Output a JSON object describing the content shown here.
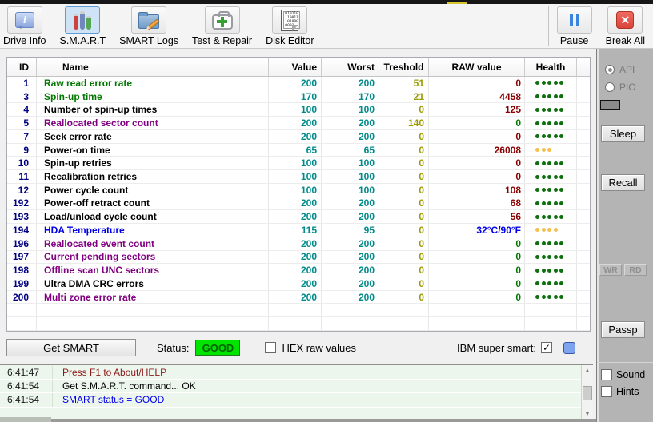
{
  "window": {
    "colors": {
      "toolbar_selected": "#cfe3f7",
      "status_good_bg": "#00e400",
      "status_good_text": "#006400",
      "sidebar_bg": "#b4b4b4",
      "log_bg": "#edf6ed",
      "id_navy": "#000080",
      "value_teal": "#008b8b",
      "treshold_olive": "#9c9c00",
      "raw_red": "#8b0000",
      "name_green": "#007800",
      "name_purple": "#800080",
      "name_blue": "#0000e8",
      "health_ok": "#0e6f0e",
      "health_warn": "#f6bf4a"
    }
  },
  "toolbar": {
    "buttons": [
      {
        "label": "Drive Info",
        "icon": "drive-info"
      },
      {
        "label": "S.M.A.R.T",
        "icon": "smart",
        "selected": true
      },
      {
        "label": "SMART Logs",
        "icon": "smart-logs"
      },
      {
        "label": "Test & Repair",
        "icon": "test-repair"
      },
      {
        "label": "Disk Editor",
        "icon": "disk-editor"
      }
    ],
    "disk_editor_binary": "010110\n110011\n101000\n0001",
    "right_buttons": [
      {
        "label": "Pause",
        "icon": "pause"
      },
      {
        "label": "Break All",
        "icon": "break-all"
      }
    ]
  },
  "table": {
    "columns": [
      "ID",
      "Name",
      "Value",
      "Worst",
      "Treshold",
      "RAW value",
      "Health"
    ],
    "empty_row_count": 2,
    "rows": [
      {
        "id": "1",
        "name": "Raw read error rate",
        "name_color": "green",
        "value": "200",
        "worst": "200",
        "treshold": "51",
        "raw": "0",
        "raw_color": "red",
        "health_dots": 5,
        "health_color": "green"
      },
      {
        "id": "3",
        "name": "Spin-up time",
        "name_color": "green",
        "value": "170",
        "worst": "170",
        "treshold": "21",
        "raw": "4458",
        "raw_color": "red",
        "health_dots": 5,
        "health_color": "green"
      },
      {
        "id": "4",
        "name": "Number of spin-up times",
        "name_color": "black",
        "value": "100",
        "worst": "100",
        "treshold": "0",
        "raw": "125",
        "raw_color": "red",
        "health_dots": 5,
        "health_color": "green"
      },
      {
        "id": "5",
        "name": "Reallocated sector count",
        "name_color": "purple",
        "value": "200",
        "worst": "200",
        "treshold": "140",
        "raw": "0",
        "raw_color": "green",
        "health_dots": 5,
        "health_color": "green"
      },
      {
        "id": "7",
        "name": "Seek error rate",
        "name_color": "black",
        "value": "200",
        "worst": "200",
        "treshold": "0",
        "raw": "0",
        "raw_color": "red",
        "health_dots": 5,
        "health_color": "green"
      },
      {
        "id": "9",
        "name": "Power-on time",
        "name_color": "black",
        "value": "65",
        "worst": "65",
        "treshold": "0",
        "raw": "26008",
        "raw_color": "red",
        "health_dots": 3,
        "health_color": "yellow"
      },
      {
        "id": "10",
        "name": "Spin-up retries",
        "name_color": "black",
        "value": "100",
        "worst": "100",
        "treshold": "0",
        "raw": "0",
        "raw_color": "red",
        "health_dots": 5,
        "health_color": "green"
      },
      {
        "id": "11",
        "name": "Recalibration retries",
        "name_color": "black",
        "value": "100",
        "worst": "100",
        "treshold": "0",
        "raw": "0",
        "raw_color": "red",
        "health_dots": 5,
        "health_color": "green"
      },
      {
        "id": "12",
        "name": "Power cycle count",
        "name_color": "black",
        "value": "100",
        "worst": "100",
        "treshold": "0",
        "raw": "108",
        "raw_color": "red",
        "health_dots": 5,
        "health_color": "green"
      },
      {
        "id": "192",
        "name": "Power-off retract count",
        "name_color": "black",
        "value": "200",
        "worst": "200",
        "treshold": "0",
        "raw": "68",
        "raw_color": "red",
        "health_dots": 5,
        "health_color": "green"
      },
      {
        "id": "193",
        "name": "Load/unload cycle count",
        "name_color": "black",
        "value": "200",
        "worst": "200",
        "treshold": "0",
        "raw": "56",
        "raw_color": "red",
        "health_dots": 5,
        "health_color": "green"
      },
      {
        "id": "194",
        "name": "HDA Temperature",
        "name_color": "blue",
        "value": "115",
        "worst": "95",
        "treshold": "0",
        "raw": "32°C/90°F",
        "raw_color": "blue",
        "health_dots": 4,
        "health_color": "yellow"
      },
      {
        "id": "196",
        "name": "Reallocated event count",
        "name_color": "purple",
        "value": "200",
        "worst": "200",
        "treshold": "0",
        "raw": "0",
        "raw_color": "green",
        "health_dots": 5,
        "health_color": "green"
      },
      {
        "id": "197",
        "name": "Current pending sectors",
        "name_color": "purple",
        "value": "200",
        "worst": "200",
        "treshold": "0",
        "raw": "0",
        "raw_color": "green",
        "health_dots": 5,
        "health_color": "green"
      },
      {
        "id": "198",
        "name": "Offline scan UNC sectors",
        "name_color": "purple",
        "value": "200",
        "worst": "200",
        "treshold": "0",
        "raw": "0",
        "raw_color": "green",
        "health_dots": 5,
        "health_color": "green"
      },
      {
        "id": "199",
        "name": "Ultra DMA CRC errors",
        "name_color": "black",
        "value": "200",
        "worst": "200",
        "treshold": "0",
        "raw": "0",
        "raw_color": "green",
        "health_dots": 5,
        "health_color": "green"
      },
      {
        "id": "200",
        "name": "Multi zone error rate",
        "name_color": "purple",
        "value": "200",
        "worst": "200",
        "treshold": "0",
        "raw": "0",
        "raw_color": "green",
        "health_dots": 5,
        "health_color": "green"
      }
    ]
  },
  "status_bar": {
    "get_smart_label": "Get SMART",
    "status_label": "Status:",
    "status_value": "GOOD",
    "hex_checkbox_label": "HEX raw values",
    "hex_checked": false,
    "ibm_label": "IBM super smart:",
    "ibm_checked": true,
    "check_glyph": "✓"
  },
  "log": {
    "entries": [
      {
        "time": "6:41:47",
        "message": "Press F1 to About/HELP",
        "color": "darkred"
      },
      {
        "time": "6:41:54",
        "message": "Get S.M.A.R.T. command... OK",
        "color": "black"
      },
      {
        "time": "6:41:54",
        "message": "SMART status = GOOD",
        "color": "blue"
      }
    ],
    "scroll_up_glyph": "▲",
    "scroll_down_glyph": "▼"
  },
  "sidebar": {
    "radio_api_label": "API",
    "radio_pio_label": "PIO",
    "api_selected": true,
    "sleep_label": "Sleep",
    "recall_label": "Recall",
    "wr_label": "WR",
    "rd_label": "RD",
    "passp_label": "Passp",
    "sound_label": "Sound",
    "hints_label": "Hints",
    "sound_checked": false,
    "hints_checked": false
  }
}
